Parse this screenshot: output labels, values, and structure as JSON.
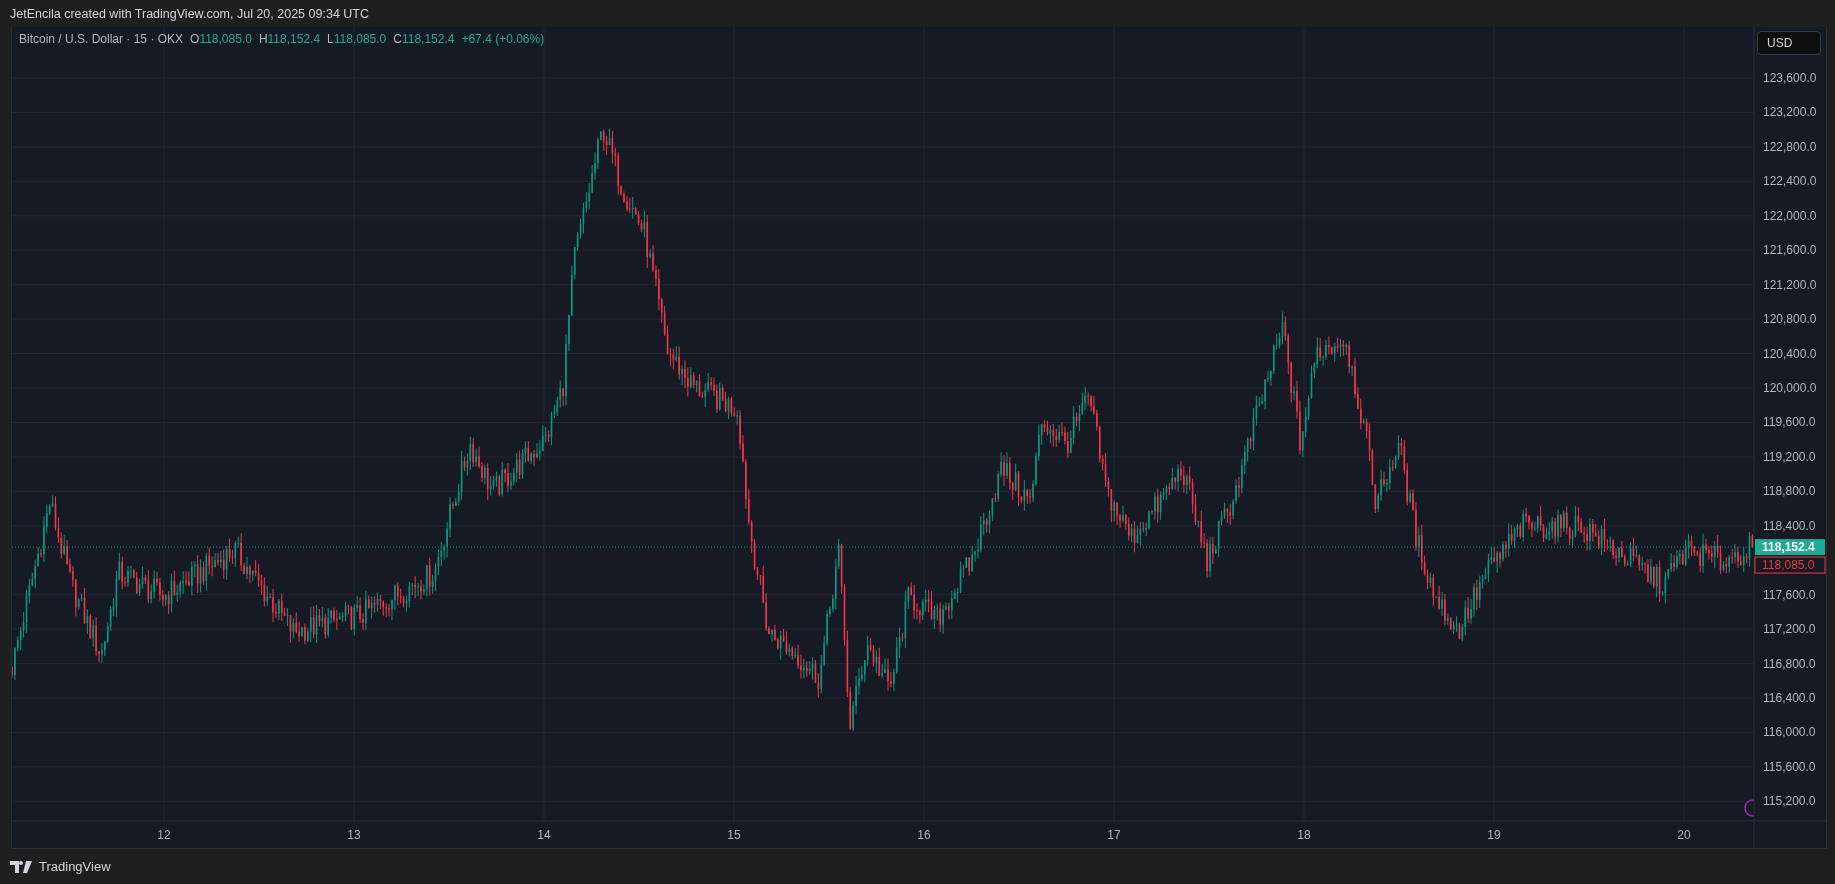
{
  "header": {
    "caption": "JetEncila created with TradingView.com, Jul 20, 2025 09:34 UTC"
  },
  "legend": {
    "title": "Bitcoin / U.S. Dollar · 15 · OKX",
    "values": [
      {
        "label": "O",
        "value": "118,085.0"
      },
      {
        "label": "H",
        "value": "118,152.4"
      },
      {
        "label": "L",
        "value": "118,085.0"
      },
      {
        "label": "C",
        "value": "118,152.4"
      }
    ],
    "change": "+67.4 (+0.06%)"
  },
  "currency_button": {
    "label": "USD"
  },
  "price_tags": [
    {
      "label": "118,152.4",
      "kind": "last"
    },
    {
      "label": "118,085.0",
      "kind": "open"
    }
  ],
  "price_axis": {
    "labels": [
      "123,600.0",
      "123,200.0",
      "122,800.0",
      "122,400.0",
      "122,000.0",
      "121,600.0",
      "121,200.0",
      "120,800.0",
      "120,400.0",
      "120,000.0",
      "119,600.0",
      "119,200.0",
      "118,800.0",
      "118,400.0",
      "117,600.0",
      "117,200.0",
      "116,800.0",
      "116,400.0",
      "116,000.0",
      "115,600.0",
      "115,200.0"
    ]
  },
  "time_axis": {
    "labels": [
      "12",
      "13",
      "14",
      "15",
      "16",
      "17",
      "18",
      "19",
      "20"
    ]
  },
  "footer": {
    "brand": "TradingView"
  }
}
